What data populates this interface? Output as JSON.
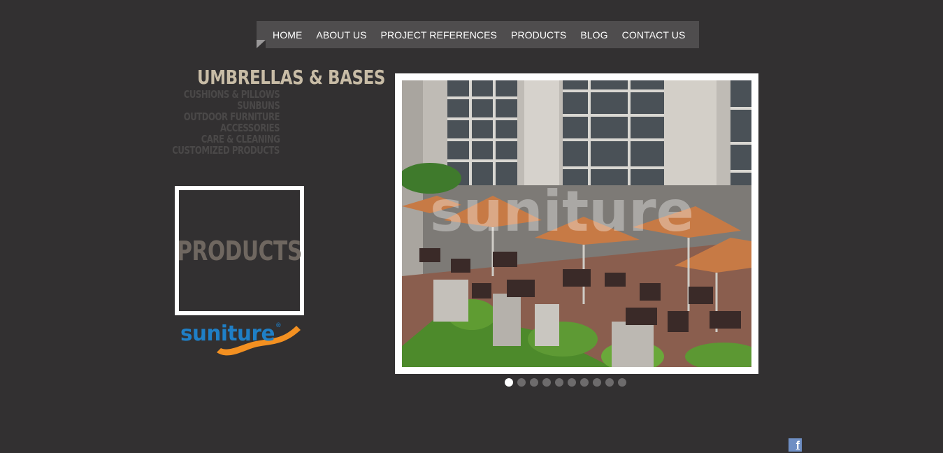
{
  "nav": {
    "items": [
      "HOME",
      "ABOUT US",
      "PROJECT REFERENCES",
      "PRODUCTS",
      "BLOG",
      "CONTACT US"
    ]
  },
  "categories": {
    "active": "UMBRELLAS & BASES",
    "items": [
      "CUSHIONS & PILLOWS",
      "SUNBUNS",
      "OUTDOOR FURNITURE",
      "ACCESSORIES",
      "CARE & CLEANING",
      "CUSTOMIZED PRODUCTS"
    ]
  },
  "section_box": {
    "label": "PRODUCTS"
  },
  "logo": {
    "text": "suniture",
    "reg": "®",
    "brand_blue": "#1f7fc6",
    "brand_orange": "#f39021"
  },
  "slider": {
    "image": "outdoor-cafe-terrace-umbrellas-photo",
    "watermark": "suniture",
    "slide_count": 10,
    "active_index": 0
  },
  "social": {
    "facebook_icon": "facebook-icon"
  },
  "colors": {
    "background": "#323031",
    "nav_bg": "#4f4d4e",
    "category_active": "#c8bca6"
  }
}
